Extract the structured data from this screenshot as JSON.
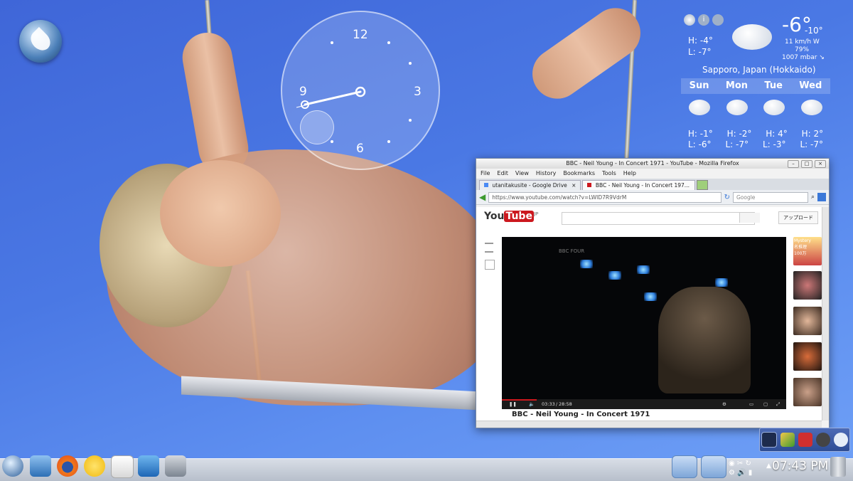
{
  "desktop": {
    "clock_widget": {
      "n12": "12",
      "n3": "3",
      "n6": "6",
      "n9": "9"
    },
    "weather": {
      "current_temp": "-6°",
      "feels_like": "-10°",
      "wind": "11 km/h W",
      "humidity": "79%",
      "pressure": "1007 mbar ↘",
      "today_high": "H: -4°",
      "today_low": "L: -7°",
      "location": "Sapporo, Japan (Hokkaido)",
      "days": [
        {
          "name": "Sun",
          "high": "H: -1°",
          "low": "L: -6°"
        },
        {
          "name": "Mon",
          "high": "H: -2°",
          "low": "L: -7°"
        },
        {
          "name": "Tue",
          "high": "H: 4°",
          "low": "L: -3°"
        },
        {
          "name": "Wed",
          "high": "H: 2°",
          "low": "L: -7°"
        }
      ]
    }
  },
  "firefox": {
    "title": "BBC - Neil Young - In Concert 1971 - YouTube - Mozilla Firefox",
    "menu": [
      "File",
      "Edit",
      "View",
      "History",
      "Bookmarks",
      "Tools",
      "Help"
    ],
    "tabs": [
      {
        "label": "utanitakusite - Google Drive"
      },
      {
        "label": "BBC - Neil Young - In Concert 197..."
      }
    ],
    "url": "https://www.youtube.com/watch?v=LWID7R9VdrM",
    "search_placeholder": "Google",
    "youtube": {
      "logo_you": "You",
      "logo_tube": "Tube",
      "logo_region": "JP",
      "upload_label": "アップロード",
      "channel_bug": "BBC FOUR",
      "time_current": "03:33",
      "time_total": "28:58",
      "progress_fraction": 0.123,
      "video_title": "BBC - Neil Young - In Concert 1971",
      "side_text_1": "Mystery",
      "side_text_2": "名推理",
      "side_text_3": "100万"
    }
  },
  "taskbar": {
    "time": "07:43 PM"
  }
}
